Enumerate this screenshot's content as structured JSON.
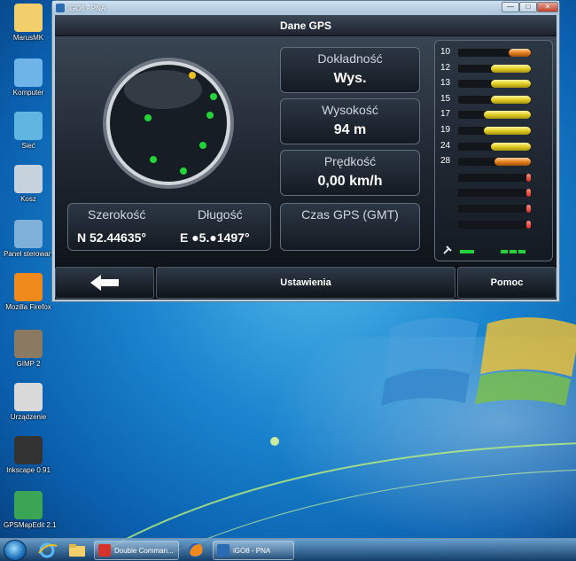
{
  "desktop": {
    "icons": [
      {
        "label": "MarusMK",
        "icon": "folder-icon"
      },
      {
        "label": "Komputer",
        "icon": "computer-icon"
      },
      {
        "label": "Sieć",
        "icon": "network-icon"
      },
      {
        "label": "Kosz",
        "icon": "recycle-bin-icon"
      },
      {
        "label": "Panel sterowania",
        "icon": "control-panel-icon"
      },
      {
        "label": "Mozilla Firefox",
        "icon": "firefox-icon"
      },
      {
        "label": "GIMP 2",
        "icon": "gimp-icon"
      },
      {
        "label": "Urządzenie",
        "icon": "device-icon"
      },
      {
        "label": "Inkscape 0.91",
        "icon": "inkscape-icon"
      },
      {
        "label": "GPSMapEdit 2.1",
        "icon": "gpsmapedit-icon"
      }
    ]
  },
  "window": {
    "title": "iGO8 - PNA",
    "controls": {
      "minimize": "—",
      "maximize": "□",
      "close": "✕"
    }
  },
  "app": {
    "header": "Dane GPS",
    "accuracy": {
      "label": "Dokładność",
      "value": "Wys."
    },
    "altitude": {
      "label": "Wysokość",
      "value": "94 m"
    },
    "speed": {
      "label": "Prędkość",
      "value": "0,00 km/h"
    },
    "latitude": {
      "label": "Szerokość",
      "value": "N 52.44635°"
    },
    "longitude": {
      "label": "Długość",
      "value": "E ●5.●1497°"
    },
    "gps_time": {
      "label": "Czas GPS (GMT)",
      "value": ""
    },
    "radar_colors": {
      "fix": "#22d43a",
      "weak": "#f0c020"
    },
    "satellites": [
      {
        "id": "10",
        "strength": 0.3,
        "color": "o"
      },
      {
        "id": "12",
        "strength": 0.55,
        "color": "y"
      },
      {
        "id": "13",
        "strength": 0.55,
        "color": "y"
      },
      {
        "id": "15",
        "strength": 0.55,
        "color": "y"
      },
      {
        "id": "17",
        "strength": 0.65,
        "color": "y"
      },
      {
        "id": "19",
        "strength": 0.65,
        "color": "y"
      },
      {
        "id": "24",
        "strength": 0.55,
        "color": "y"
      },
      {
        "id": "28",
        "strength": 0.5,
        "color": "o"
      },
      {
        "id": "",
        "strength": 0.05,
        "color": "r"
      },
      {
        "id": "",
        "strength": 0.05,
        "color": "r"
      },
      {
        "id": "",
        "strength": 0.05,
        "color": "r"
      },
      {
        "id": "",
        "strength": 0.05,
        "color": "r"
      }
    ],
    "footer": {
      "back_icon": "arrow-left-icon",
      "settings": "Ustawienia",
      "help": "Pomoc"
    }
  },
  "taskbar": {
    "tasks": [
      {
        "label": "Double Comman...",
        "icon": "double-commander-icon"
      },
      {
        "label": "iGO8 - PNA",
        "icon": "igo-icon"
      }
    ]
  }
}
